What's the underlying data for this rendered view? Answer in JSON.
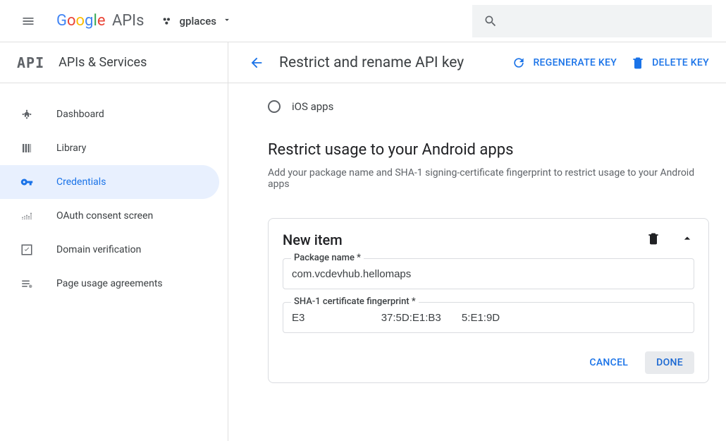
{
  "header": {
    "project_name": "gplaces"
  },
  "sidebar": {
    "title": "APIs & Services",
    "items": [
      {
        "label": "Dashboard"
      },
      {
        "label": "Library"
      },
      {
        "label": "Credentials"
      },
      {
        "label": "OAuth consent screen"
      },
      {
        "label": "Domain verification"
      },
      {
        "label": "Page usage agreements"
      }
    ]
  },
  "page": {
    "title": "Restrict and rename API key",
    "regenerate": "REGENERATE KEY",
    "delete": "DELETE KEY",
    "radio_ios": "iOS apps",
    "section_title": "Restrict usage to your Android apps",
    "section_desc": "Add your package name and SHA-1 signing-certificate fingerprint to restrict usage to your Android apps"
  },
  "card": {
    "title": "New item",
    "package_label": "Package name *",
    "package_value": "com.vcdevhub.hellomaps",
    "sha_label": "SHA-1 certificate fingerprint *",
    "sha_value": "E3                          37:5D:E1:B3       5:E1:9D                          ",
    "cancel": "CANCEL",
    "done": "DONE"
  }
}
